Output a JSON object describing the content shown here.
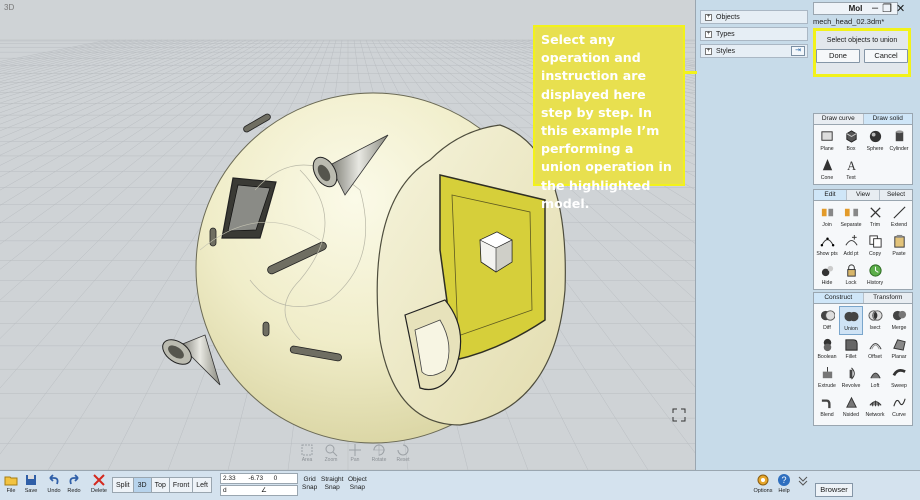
{
  "viewport": {
    "label": "3D"
  },
  "annotation": {
    "text": "Select any operation and instruction are displayed here step by step. In this example I’m performing a union operation in the highlighted model."
  },
  "app": {
    "title": "MoI",
    "file_name": "mech_head_02.3dm*"
  },
  "scene_browser": {
    "rows": [
      {
        "label": "Objects"
      },
      {
        "label": "Types"
      },
      {
        "label": "Styles"
      }
    ]
  },
  "command": {
    "prompt": "Select objects to union",
    "done": "Done",
    "cancel": "Cancel"
  },
  "palette_draw": {
    "tabs": [
      "Draw curve",
      "Draw solid"
    ],
    "active_tab": 1,
    "tools": [
      {
        "label": "Plane",
        "icon": "plane-icon"
      },
      {
        "label": "Box",
        "icon": "box-icon"
      },
      {
        "label": "Sphere",
        "icon": "sphere-icon"
      },
      {
        "label": "Cylinder",
        "icon": "cylinder-icon"
      },
      {
        "label": "Cone",
        "icon": "cone-icon"
      },
      {
        "label": "Text",
        "icon": "text-icon"
      }
    ]
  },
  "palette_edit": {
    "tabs": [
      "Edit",
      "View",
      "Select"
    ],
    "active_tab": 0,
    "tools": [
      {
        "label": "Join",
        "icon": "join-icon"
      },
      {
        "label": "Separate",
        "icon": "separate-icon"
      },
      {
        "label": "Trim",
        "icon": "trim-icon"
      },
      {
        "label": "Extend",
        "icon": "extend-icon"
      },
      {
        "label": "Show pts",
        "icon": "show-points-icon"
      },
      {
        "label": "Add pt",
        "icon": "add-point-icon"
      },
      {
        "label": "Copy",
        "icon": "copy-icon"
      },
      {
        "label": "Paste",
        "icon": "paste-icon"
      },
      {
        "label": "Hide",
        "icon": "hide-icon"
      },
      {
        "label": "Lock",
        "icon": "lock-icon"
      },
      {
        "label": "History",
        "icon": "history-icon"
      }
    ]
  },
  "palette_construct": {
    "tabs": [
      "Construct",
      "Transform"
    ],
    "active_tab": 0,
    "tools": [
      {
        "label": "Diff",
        "icon": "boolean-difference-icon"
      },
      {
        "label": "Union",
        "icon": "boolean-union-icon",
        "active": true
      },
      {
        "label": "Isect",
        "icon": "boolean-intersect-icon"
      },
      {
        "label": "Merge",
        "icon": "merge-icon"
      },
      {
        "label": "Boolean",
        "icon": "boolean-icon"
      },
      {
        "label": "Fillet",
        "icon": "fillet-icon"
      },
      {
        "label": "Offset",
        "icon": "offset-icon"
      },
      {
        "label": "Planar",
        "icon": "planar-icon"
      },
      {
        "label": "Extrude",
        "icon": "extrude-icon"
      },
      {
        "label": "Revolve",
        "icon": "revolve-icon"
      },
      {
        "label": "Loft",
        "icon": "loft-icon"
      },
      {
        "label": "Sweep",
        "icon": "sweep-icon"
      },
      {
        "label": "Blend",
        "icon": "blend-icon"
      },
      {
        "label": "Nsided",
        "icon": "nsided-icon"
      },
      {
        "label": "Network",
        "icon": "network-icon"
      },
      {
        "label": "Curve",
        "icon": "curve-icon"
      }
    ]
  },
  "nav_tools": [
    "Area",
    "Zoom",
    "Pan",
    "Rotate",
    "Reset"
  ],
  "bottom": {
    "file_buttons": [
      {
        "label": "File",
        "icon": "folder-icon"
      },
      {
        "label": "Save",
        "icon": "save-icon"
      },
      {
        "label": "Undo",
        "icon": "undo-icon"
      },
      {
        "label": "Redo",
        "icon": "redo-icon"
      },
      {
        "label": "Delete",
        "icon": "delete-icon"
      }
    ],
    "view_tabs": [
      "Split",
      "3D",
      "Top",
      "Front",
      "Left"
    ],
    "active_view": "3D",
    "coords": {
      "x": "2.33",
      "y": "-6.73",
      "z": "0",
      "d_label": "d",
      "angle_label": "∠"
    },
    "snaps": [
      {
        "line1": "Grid",
        "line2": "Snap"
      },
      {
        "line1": "Straight",
        "line2": "Snap"
      },
      {
        "line1": "Object",
        "line2": "Snap"
      }
    ],
    "options": "Options",
    "help": "Help",
    "browser": "Browser"
  },
  "colors": {
    "annotation": "#f2f21a",
    "model": "#f1eecb",
    "highlight": "#d6cf3a"
  }
}
